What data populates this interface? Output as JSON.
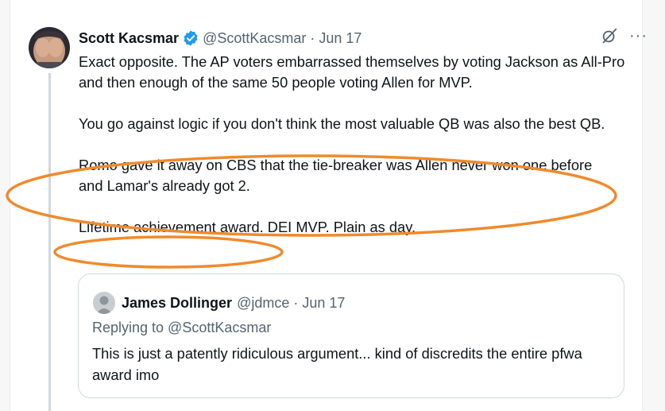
{
  "tweet": {
    "author_name": "Scott Kacsmar",
    "handle": "@ScottKacsmar",
    "separator": "·",
    "date": "Jun 17",
    "more_label": "···",
    "paragraphs": [
      "Exact opposite. The AP voters embarrassed themselves by voting Jackson as All-Pro and then enough of the same 50 people voting Allen for MVP.",
      "You go against logic if you don't think the most valuable QB was also the best QB.",
      "Romo gave it away on CBS that the tie-breaker was Allen never won one before and Lamar's already got 2.",
      "Lifetime achievement award. DEI MVP. Plain as day."
    ]
  },
  "quoted": {
    "author_name": "James Dollinger",
    "handle": "@jdmce",
    "separator": "·",
    "date": "Jun 17",
    "replying_to": "Replying to @ScottKacsmar",
    "text": "This is just a patently ridiculous argument... kind of discredits the entire pfwa award imo"
  },
  "icons": {
    "verified": "verified-badge-icon",
    "grok": "grok-icon",
    "more": "more-icon"
  },
  "colors": {
    "text": "#0f1419",
    "secondary": "#536471",
    "verified": "#1d9bf0",
    "annotation": "#f08a2c",
    "border": "#cfd9de"
  }
}
